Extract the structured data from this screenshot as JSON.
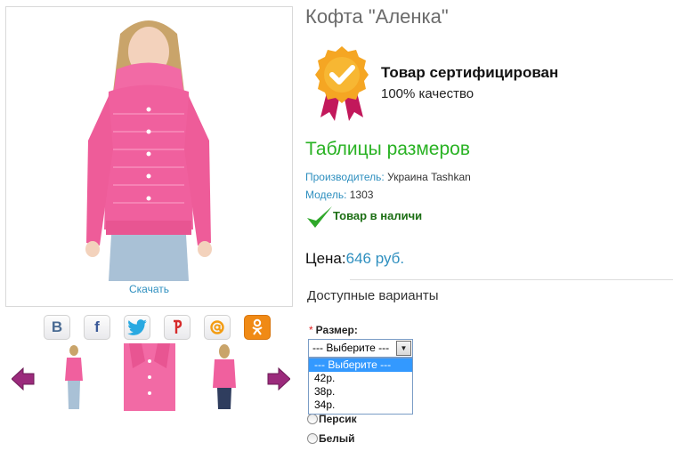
{
  "product": {
    "title": "Кофта \"Аленка\"",
    "download_label": "Скачать"
  },
  "share": {
    "icons": [
      "vk-icon",
      "facebook-icon",
      "twitter-icon",
      "yandex-icon",
      "mail-icon",
      "odnoklassniki-icon"
    ],
    "vk_glyph": "B",
    "fb_glyph": "f"
  },
  "certificate": {
    "title": "Товар сертифицирован",
    "subtitle": "100% качество"
  },
  "size_tables_label": "Таблицы размеров",
  "manufacturer": {
    "label": "Производитель:",
    "value": "Украина Tashkan"
  },
  "model": {
    "label": "Модель:",
    "value": "1303"
  },
  "stock_label": "Товар в наличи",
  "price": {
    "label": "Цена:",
    "value": "646 руб."
  },
  "variants_title": "Доступные варианты",
  "size": {
    "required_mark": "*",
    "label": "Размер:",
    "selected": "--- Выберите ---",
    "options": [
      "--- Выберите ---",
      "42р.",
      "38р.",
      "34р."
    ]
  },
  "colors": [
    "Персик",
    "Белый"
  ],
  "colors_palette": {
    "accent_green": "#29b223",
    "link_blue": "#2e8fbf",
    "sweater_pink": "#f0609e",
    "arrow_purple": "#9b2a7c"
  }
}
